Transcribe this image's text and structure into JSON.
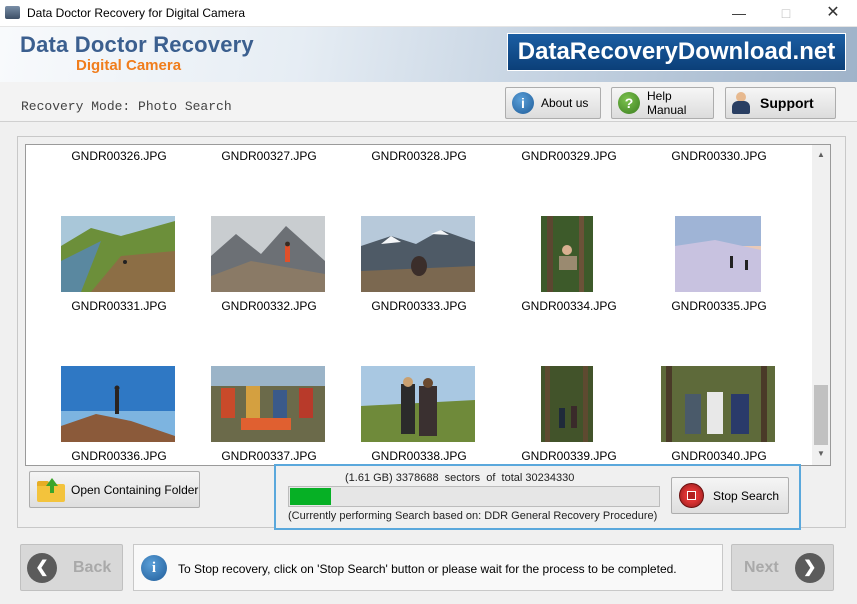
{
  "window": {
    "title": "Data Doctor Recovery for Digital Camera",
    "min_icon": "minimize-icon",
    "max_icon": "maximize-icon",
    "close_icon": "close-icon"
  },
  "banner": {
    "brand_line1": "Data Doctor Recovery",
    "brand_line2": "Digital Camera",
    "website": "DataRecoveryDownload.net"
  },
  "toolbar": {
    "mode": "Recovery Mode: Photo Search",
    "about": "About us",
    "help": "Help Manual",
    "support": "Support"
  },
  "gallery": {
    "header_files": [
      "GNDR00326.JPG",
      "GNDR00327.JPG",
      "GNDR00328.JPG",
      "GNDR00329.JPG",
      "GNDR00330.JPG"
    ],
    "rows": [
      [
        "GNDR00331.JPG",
        "GNDR00332.JPG",
        "GNDR00333.JPG",
        "GNDR00334.JPG",
        "GNDR00335.JPG"
      ],
      [
        "GNDR00336.JPG",
        "GNDR00337.JPG",
        "GNDR00338.JPG",
        "GNDR00339.JPG",
        "GNDR00340.JPG"
      ]
    ]
  },
  "actions": {
    "open_folder": "Open Containing Folder",
    "stop_search": "Stop Search"
  },
  "progress": {
    "sectors_text": "(1.61 GB) 3378688  sectors  of  total 30234330",
    "fraction": 0.112,
    "procedure": "(Currently performing Search based on:  DDR General Recovery Procedure)",
    "bar_color": "#06b025"
  },
  "footer": {
    "back": "Back",
    "next": "Next",
    "info": "To Stop recovery, click on 'Stop Search' button or please wait for the process to be completed."
  },
  "colors": {
    "brand_blue": "#3b5f8f",
    "brand_orange": "#f07d1c",
    "highlight_border": "#5aa8dc"
  }
}
